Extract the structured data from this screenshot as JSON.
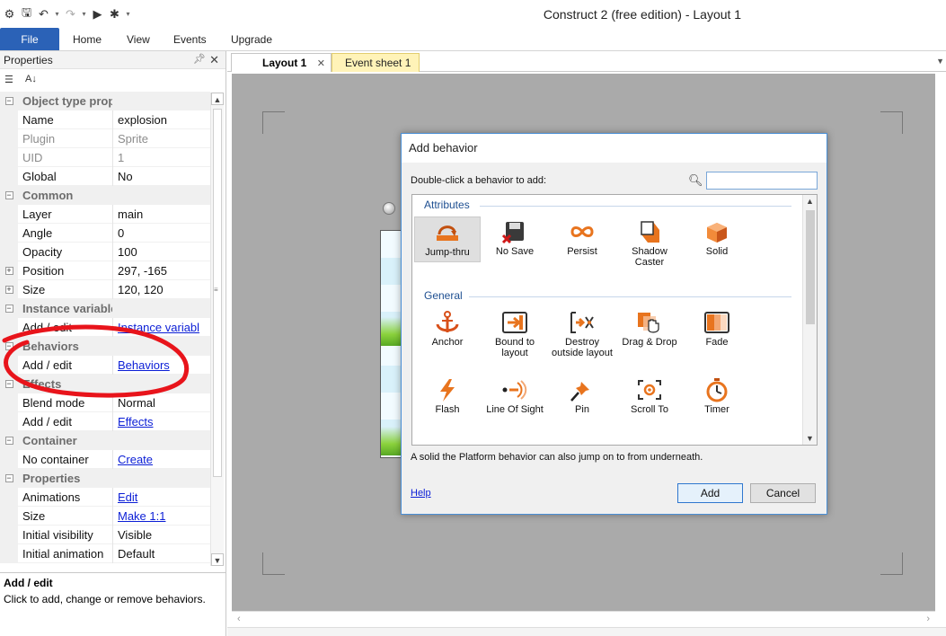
{
  "window": {
    "title": "Construct 2  (free edition) - Layout 1"
  },
  "ribbon": {
    "file_label": "File",
    "tabs": [
      "Home",
      "View",
      "Events",
      "Upgrade"
    ]
  },
  "properties": {
    "title": "Properties",
    "rows": [
      {
        "type": "category",
        "label": "Object type properties"
      },
      {
        "label": "Name",
        "value": "explosion"
      },
      {
        "label": "Plugin",
        "value": "Sprite",
        "dim": true
      },
      {
        "label": "UID",
        "value": "1",
        "dim": true
      },
      {
        "label": "Global",
        "value": "No"
      },
      {
        "type": "category",
        "label": "Common"
      },
      {
        "label": "Layer",
        "value": "main"
      },
      {
        "label": "Angle",
        "value": "0"
      },
      {
        "label": "Opacity",
        "value": "100"
      },
      {
        "label": "Position",
        "value": "297, -165",
        "expander": true
      },
      {
        "label": "Size",
        "value": "120, 120",
        "expander": true
      },
      {
        "type": "category",
        "label": "Instance variables"
      },
      {
        "label": "Add / edit",
        "value": "Instance variabl",
        "link": true
      },
      {
        "type": "category",
        "label": "Behaviors"
      },
      {
        "label": "Add / edit",
        "value": "Behaviors",
        "link": true
      },
      {
        "type": "category",
        "label": "Effects"
      },
      {
        "label": "Blend mode",
        "value": "Normal"
      },
      {
        "label": "Add / edit",
        "value": "Effects",
        "link": true
      },
      {
        "type": "category",
        "label": "Container"
      },
      {
        "label": "No container",
        "value": "Create",
        "link": true
      },
      {
        "type": "category",
        "label": "Properties"
      },
      {
        "label": "Animations",
        "value": "Edit",
        "link": true
      },
      {
        "label": "Size",
        "value": "Make 1:1",
        "link": true
      },
      {
        "label": "Initial visibility",
        "value": "Visible"
      },
      {
        "label": "Initial animation",
        "value": "Default"
      }
    ],
    "description": {
      "title": "Add / edit",
      "text": "Click to add, change or remove behaviors."
    }
  },
  "doc_tabs": {
    "layout": "Layout 1",
    "events": "Event sheet 1"
  },
  "dialog": {
    "title": "Add behavior",
    "prompt": "Double-click a behavior to add:",
    "search_value": "",
    "groups": [
      {
        "name": "Attributes",
        "items": [
          {
            "label": "Jump-thru",
            "icon": "jump-thru-icon",
            "selected": true
          },
          {
            "label": "No Save",
            "icon": "no-save-icon"
          },
          {
            "label": "Persist",
            "icon": "persist-icon"
          },
          {
            "label": "Shadow Caster",
            "icon": "shadow-caster-icon"
          },
          {
            "label": "Solid",
            "icon": "solid-icon"
          }
        ]
      },
      {
        "name": "General",
        "items": [
          {
            "label": "Anchor",
            "icon": "anchor-icon"
          },
          {
            "label": "Bound to layout",
            "icon": "bound-to-layout-icon"
          },
          {
            "label": "Destroy outside layout",
            "icon": "destroy-outside-layout-icon"
          },
          {
            "label": "Drag & Drop",
            "icon": "drag-drop-icon"
          },
          {
            "label": "Fade",
            "icon": "fade-icon"
          },
          {
            "label": "Flash",
            "icon": "flash-icon"
          },
          {
            "label": "Line Of Sight",
            "icon": "line-of-sight-icon"
          },
          {
            "label": "Pin",
            "icon": "pin-icon"
          },
          {
            "label": "Scroll To",
            "icon": "scroll-to-icon"
          },
          {
            "label": "Timer",
            "icon": "timer-icon"
          }
        ]
      }
    ],
    "description": "A solid the Platform behavior can also jump on to from underneath.",
    "help_label": "Help",
    "add_label": "Add",
    "cancel_label": "Cancel"
  },
  "colors": {
    "accent": "#2b62b7",
    "icon_orange": "#e8741e",
    "annotation_red": "#e8141b"
  }
}
